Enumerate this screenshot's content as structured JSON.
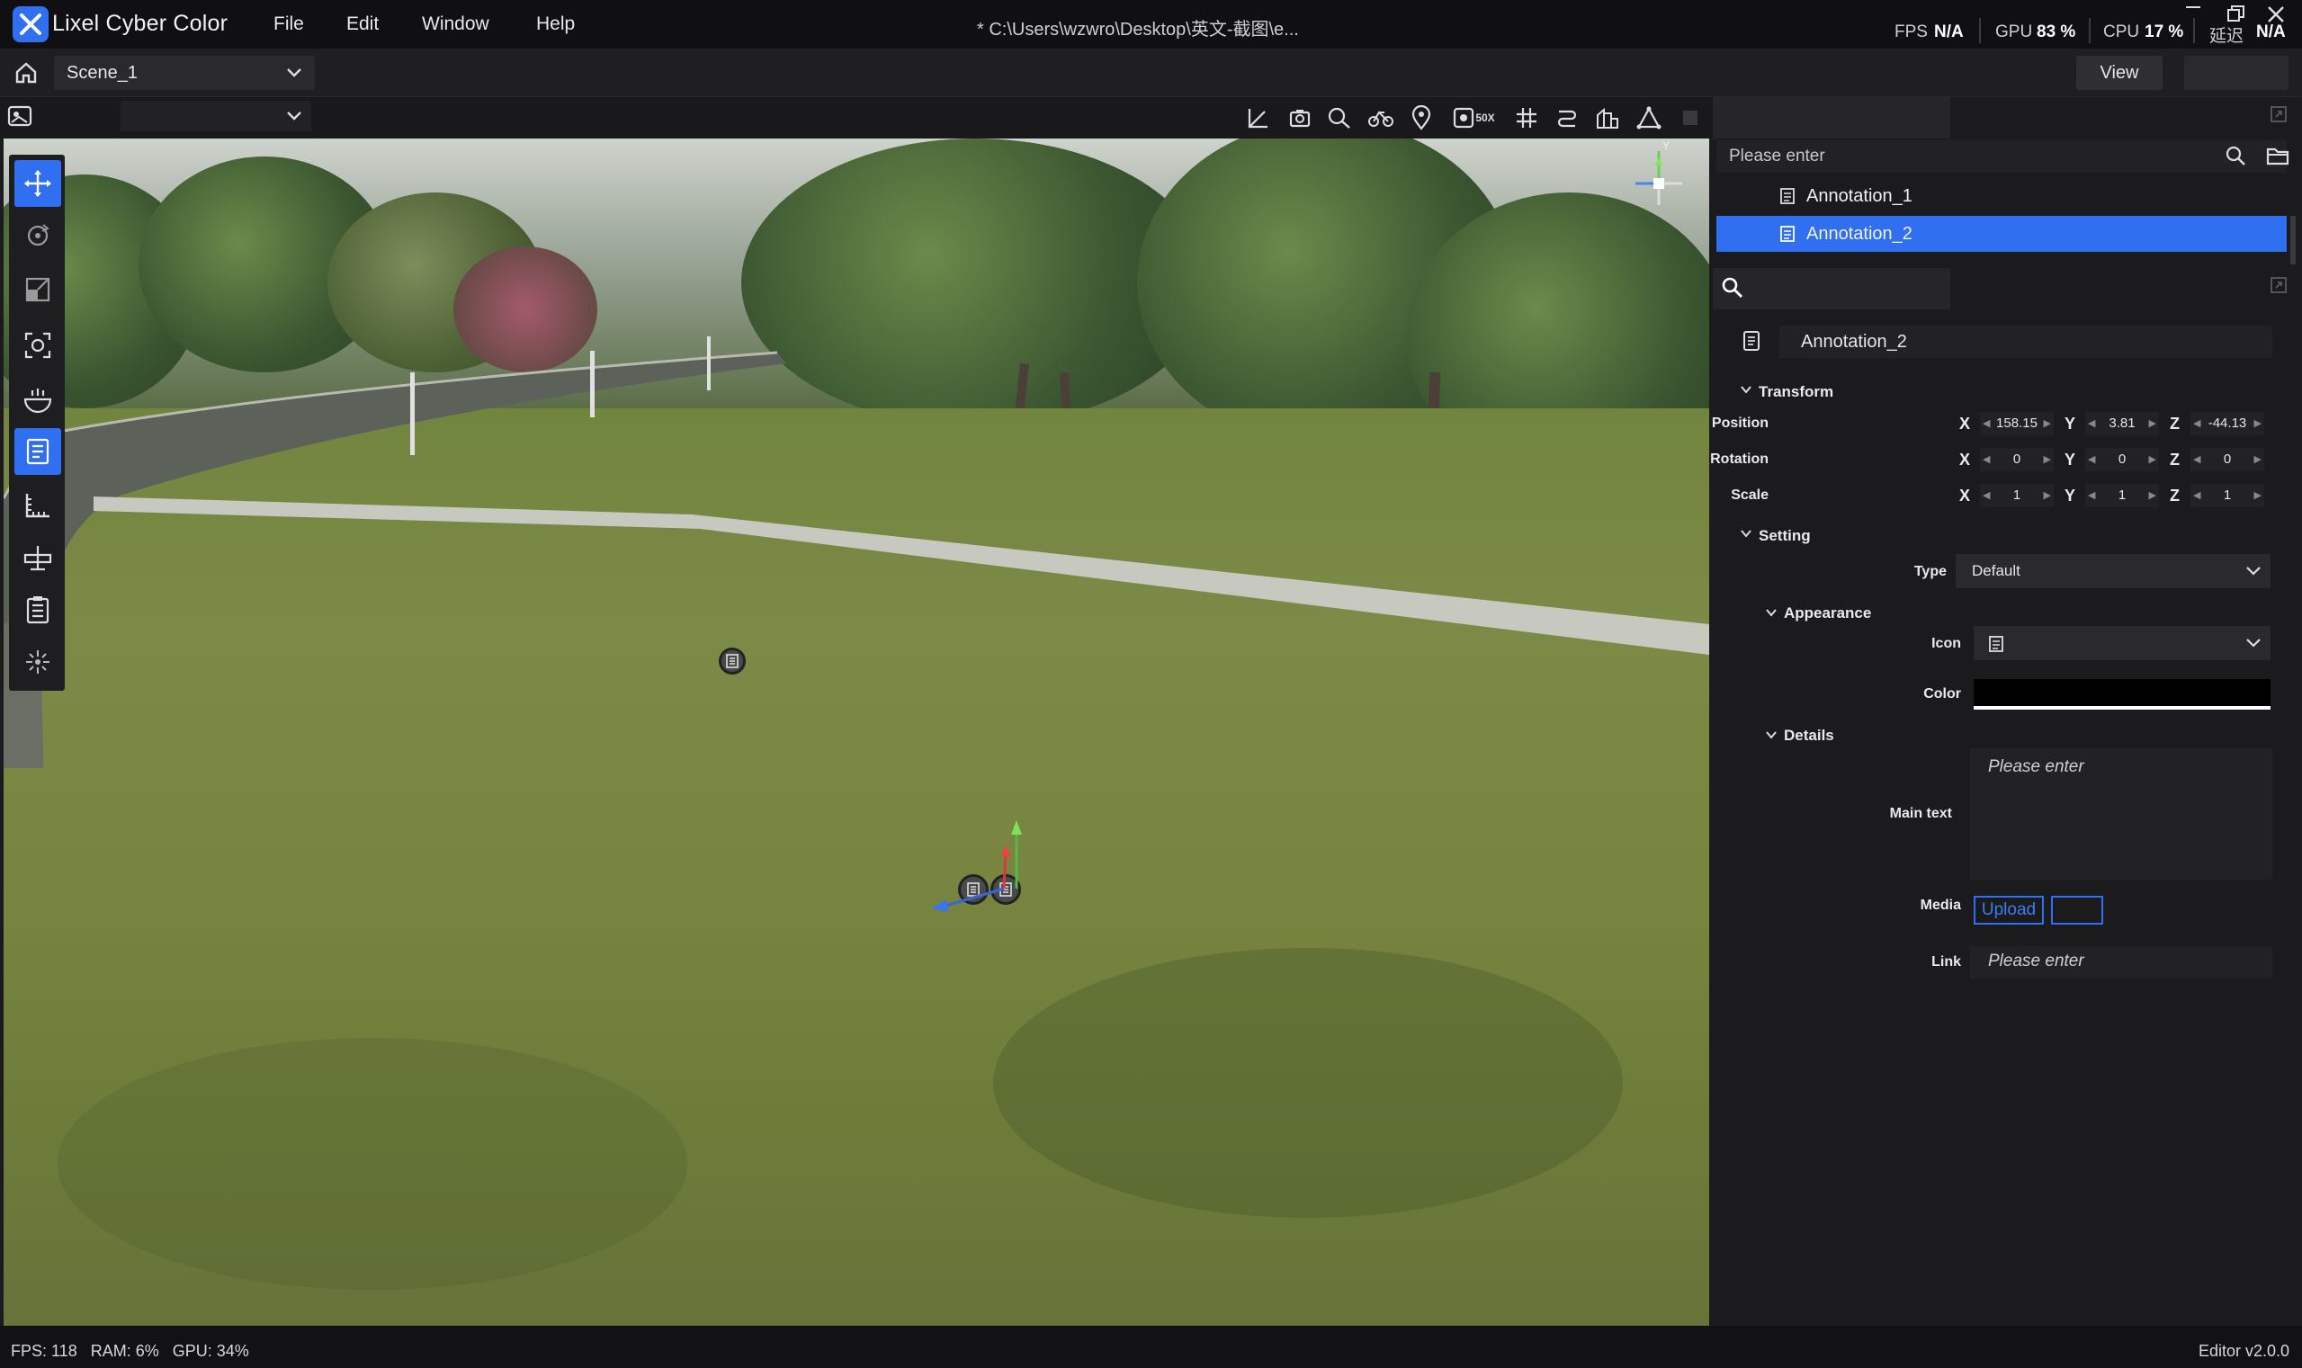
{
  "app": {
    "title": "Lixel Cyber Color",
    "file_path": "* C:\\Users\\wzwro\\Desktop\\英文-截图\\e..."
  },
  "menu": [
    "File",
    "Edit",
    "Window",
    "Help"
  ],
  "stats": {
    "fps_label": "FPS",
    "fps_value": "N/A",
    "gpu_label": "GPU",
    "gpu_value": "83 %",
    "cpu_label": "CPU",
    "cpu_value": "17 %",
    "latency_label": "延迟",
    "latency_value": "N/A"
  },
  "scene": {
    "selected": "Scene_1"
  },
  "view_button": "View",
  "toolbar_icons": [
    "axis-icon",
    "camera-icon",
    "search-zoom-icon",
    "bike-icon",
    "location-pin-icon",
    "50x-icon",
    "grid-icon",
    "path-icon",
    "measure-building-icon",
    "triangle-icon",
    "square-icon",
    "hierarchy-icon"
  ],
  "toolbar_badge": "50X",
  "tools": [
    "move-icon",
    "rotate-icon",
    "scale-icon",
    "focus-icon",
    "clipping-icon",
    "annotation-icon",
    "measure-icon",
    "section-icon",
    "clipboard-icon",
    "ai-icon"
  ],
  "gizmo_label": "Y",
  "outline": {
    "search_placeholder": "Please enter",
    "items": [
      {
        "label": "Annotation_1",
        "selected": false
      },
      {
        "label": "Annotation_2",
        "selected": true
      }
    ]
  },
  "inspector": {
    "name": "Annotation_2",
    "transform": {
      "title": "Transform",
      "position": {
        "label": "Position",
        "x": "158.15",
        "y": "3.81",
        "z": "-44.13"
      },
      "rotation": {
        "label": "Rotation",
        "x": "0",
        "y": "0",
        "z": "0"
      },
      "scale": {
        "label": "Scale",
        "x": "1",
        "y": "1",
        "z": "1"
      },
      "axes": [
        "X",
        "Y",
        "Z"
      ]
    },
    "setting": {
      "title": "Setting",
      "type_label": "Type",
      "type_value": "Default",
      "appearance": {
        "title": "Appearance",
        "icon_label": "Icon",
        "color_label": "Color",
        "color_value": "#000000"
      },
      "details": {
        "title": "Details",
        "main_text_label": "Main text",
        "main_text_placeholder": "Please enter",
        "media_label": "Media",
        "upload_label": "Upload",
        "link_label": "Link",
        "link_placeholder": "Please enter"
      }
    }
  },
  "status": {
    "left": "FPS: 118   RAM: 6%   GPU: 34%",
    "right": "Editor v2.0.0"
  },
  "colors": {
    "accent": "#2f6ff0",
    "panel": "#1b1b1d"
  }
}
